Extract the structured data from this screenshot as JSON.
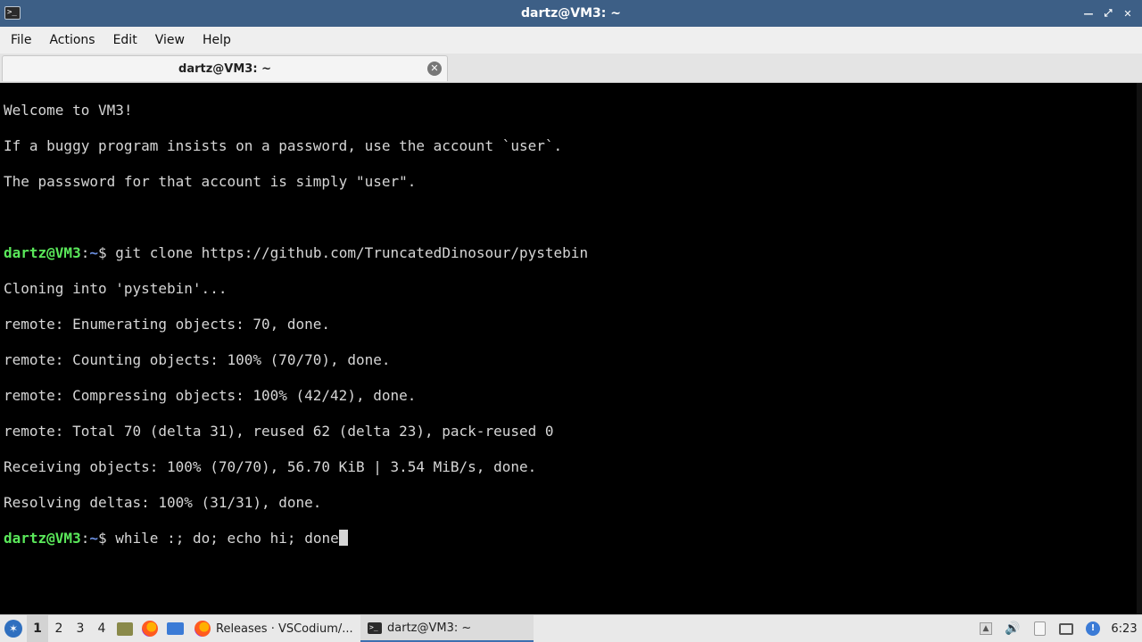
{
  "window": {
    "title": "dartz@VM3: ~",
    "app_icon": "terminal-icon",
    "controls": [
      "minimize-icon",
      "maximize-icon",
      "close-icon"
    ]
  },
  "menubar": {
    "items": [
      "File",
      "Actions",
      "Edit",
      "View",
      "Help"
    ]
  },
  "tabs": [
    {
      "label": "dartz@VM3: ~",
      "close_icon": "close-circle-icon"
    }
  ],
  "terminal": {
    "prompt": {
      "user": "dartz@VM3",
      "path": "~",
      "symbol": "$"
    },
    "lines": [
      "Welcome to VM3!",
      "If a buggy program insists on a password, use the account `user`.",
      "The passsword for that account is simply \"user\".",
      "",
      "remote: Enumerating objects: 70, done.",
      "remote: Counting objects: 100% (70/70), done.",
      "remote: Compressing objects: 100% (42/42), done.",
      "remote: Total 70 (delta 31), reused 62 (delta 23), pack-reused 0",
      "Receiving objects: 100% (70/70), 56.70 KiB | 3.54 MiB/s, done.",
      "Resolving deltas: 100% (31/31), done."
    ],
    "cmd1": "git clone https://github.com/TruncatedDinosour/pystebin",
    "cloning": "Cloning into 'pystebin'...",
    "cmd2": "while :; do; echo hi; done"
  },
  "taskbar": {
    "start_icon": "lxqt-menu-icon",
    "desktops": [
      "1",
      "2",
      "3",
      "4"
    ],
    "active_desktop": "1",
    "launchers": [
      "file-manager-icon",
      "firefox-icon",
      "show-desktop-icon"
    ],
    "tasks": [
      {
        "label": "Releases · VSCodium/...",
        "icon": "firefox-icon"
      },
      {
        "label": "dartz@VM3: ~",
        "icon": "terminal-icon"
      }
    ],
    "tray": [
      "tray-expand-icon",
      "volume-icon",
      "clipboard-icon",
      "network-icon",
      "update-notifier-icon"
    ],
    "clock": "6:23"
  },
  "colors": {
    "titlebar": "#3d5f86",
    "prompt_user": "#5ae85a",
    "prompt_path": "#6b8fe0",
    "terminal_bg": "#000000",
    "terminal_fg": "#d6d6d6"
  }
}
